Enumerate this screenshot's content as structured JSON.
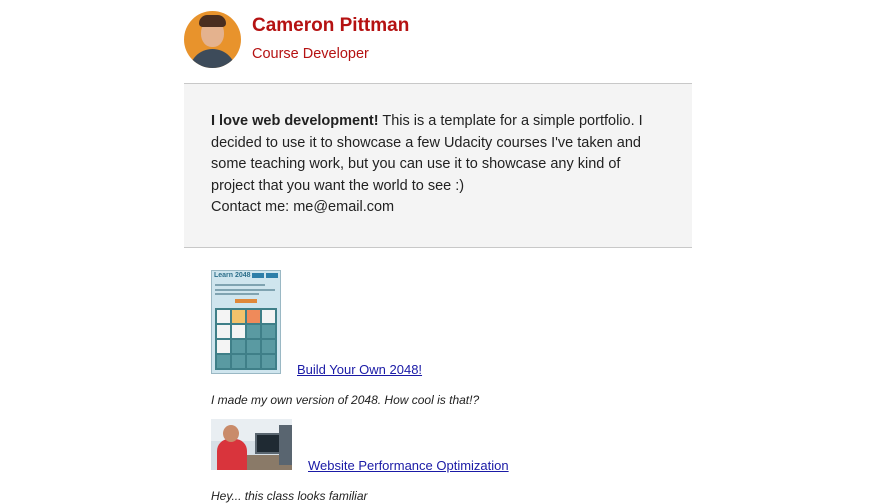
{
  "profile": {
    "name": "Cameron Pittman",
    "role": "Course Developer"
  },
  "about": {
    "lead": "I love web development!",
    "text": " This is a template for a simple portfolio. I decided to use it to showcase a few Udacity courses I've taken and some teaching work, but you can use it to showcase any kind of project that you want the world to see :)",
    "contact": "Contact me: me@email.com"
  },
  "projects": [
    {
      "title": "Build Your Own 2048!",
      "description": "I made my own version of 2048. How cool is that!?",
      "thumbnail_text": "Learn 2048"
    },
    {
      "title": "Website Performance Optimization",
      "description": "Hey... this class looks familiar"
    }
  ],
  "colors": {
    "accent": "#b51212",
    "link": "#1a1aa6",
    "panel": "#f4f4f4"
  },
  "icons": {
    "avatar": "avatar-photo"
  }
}
